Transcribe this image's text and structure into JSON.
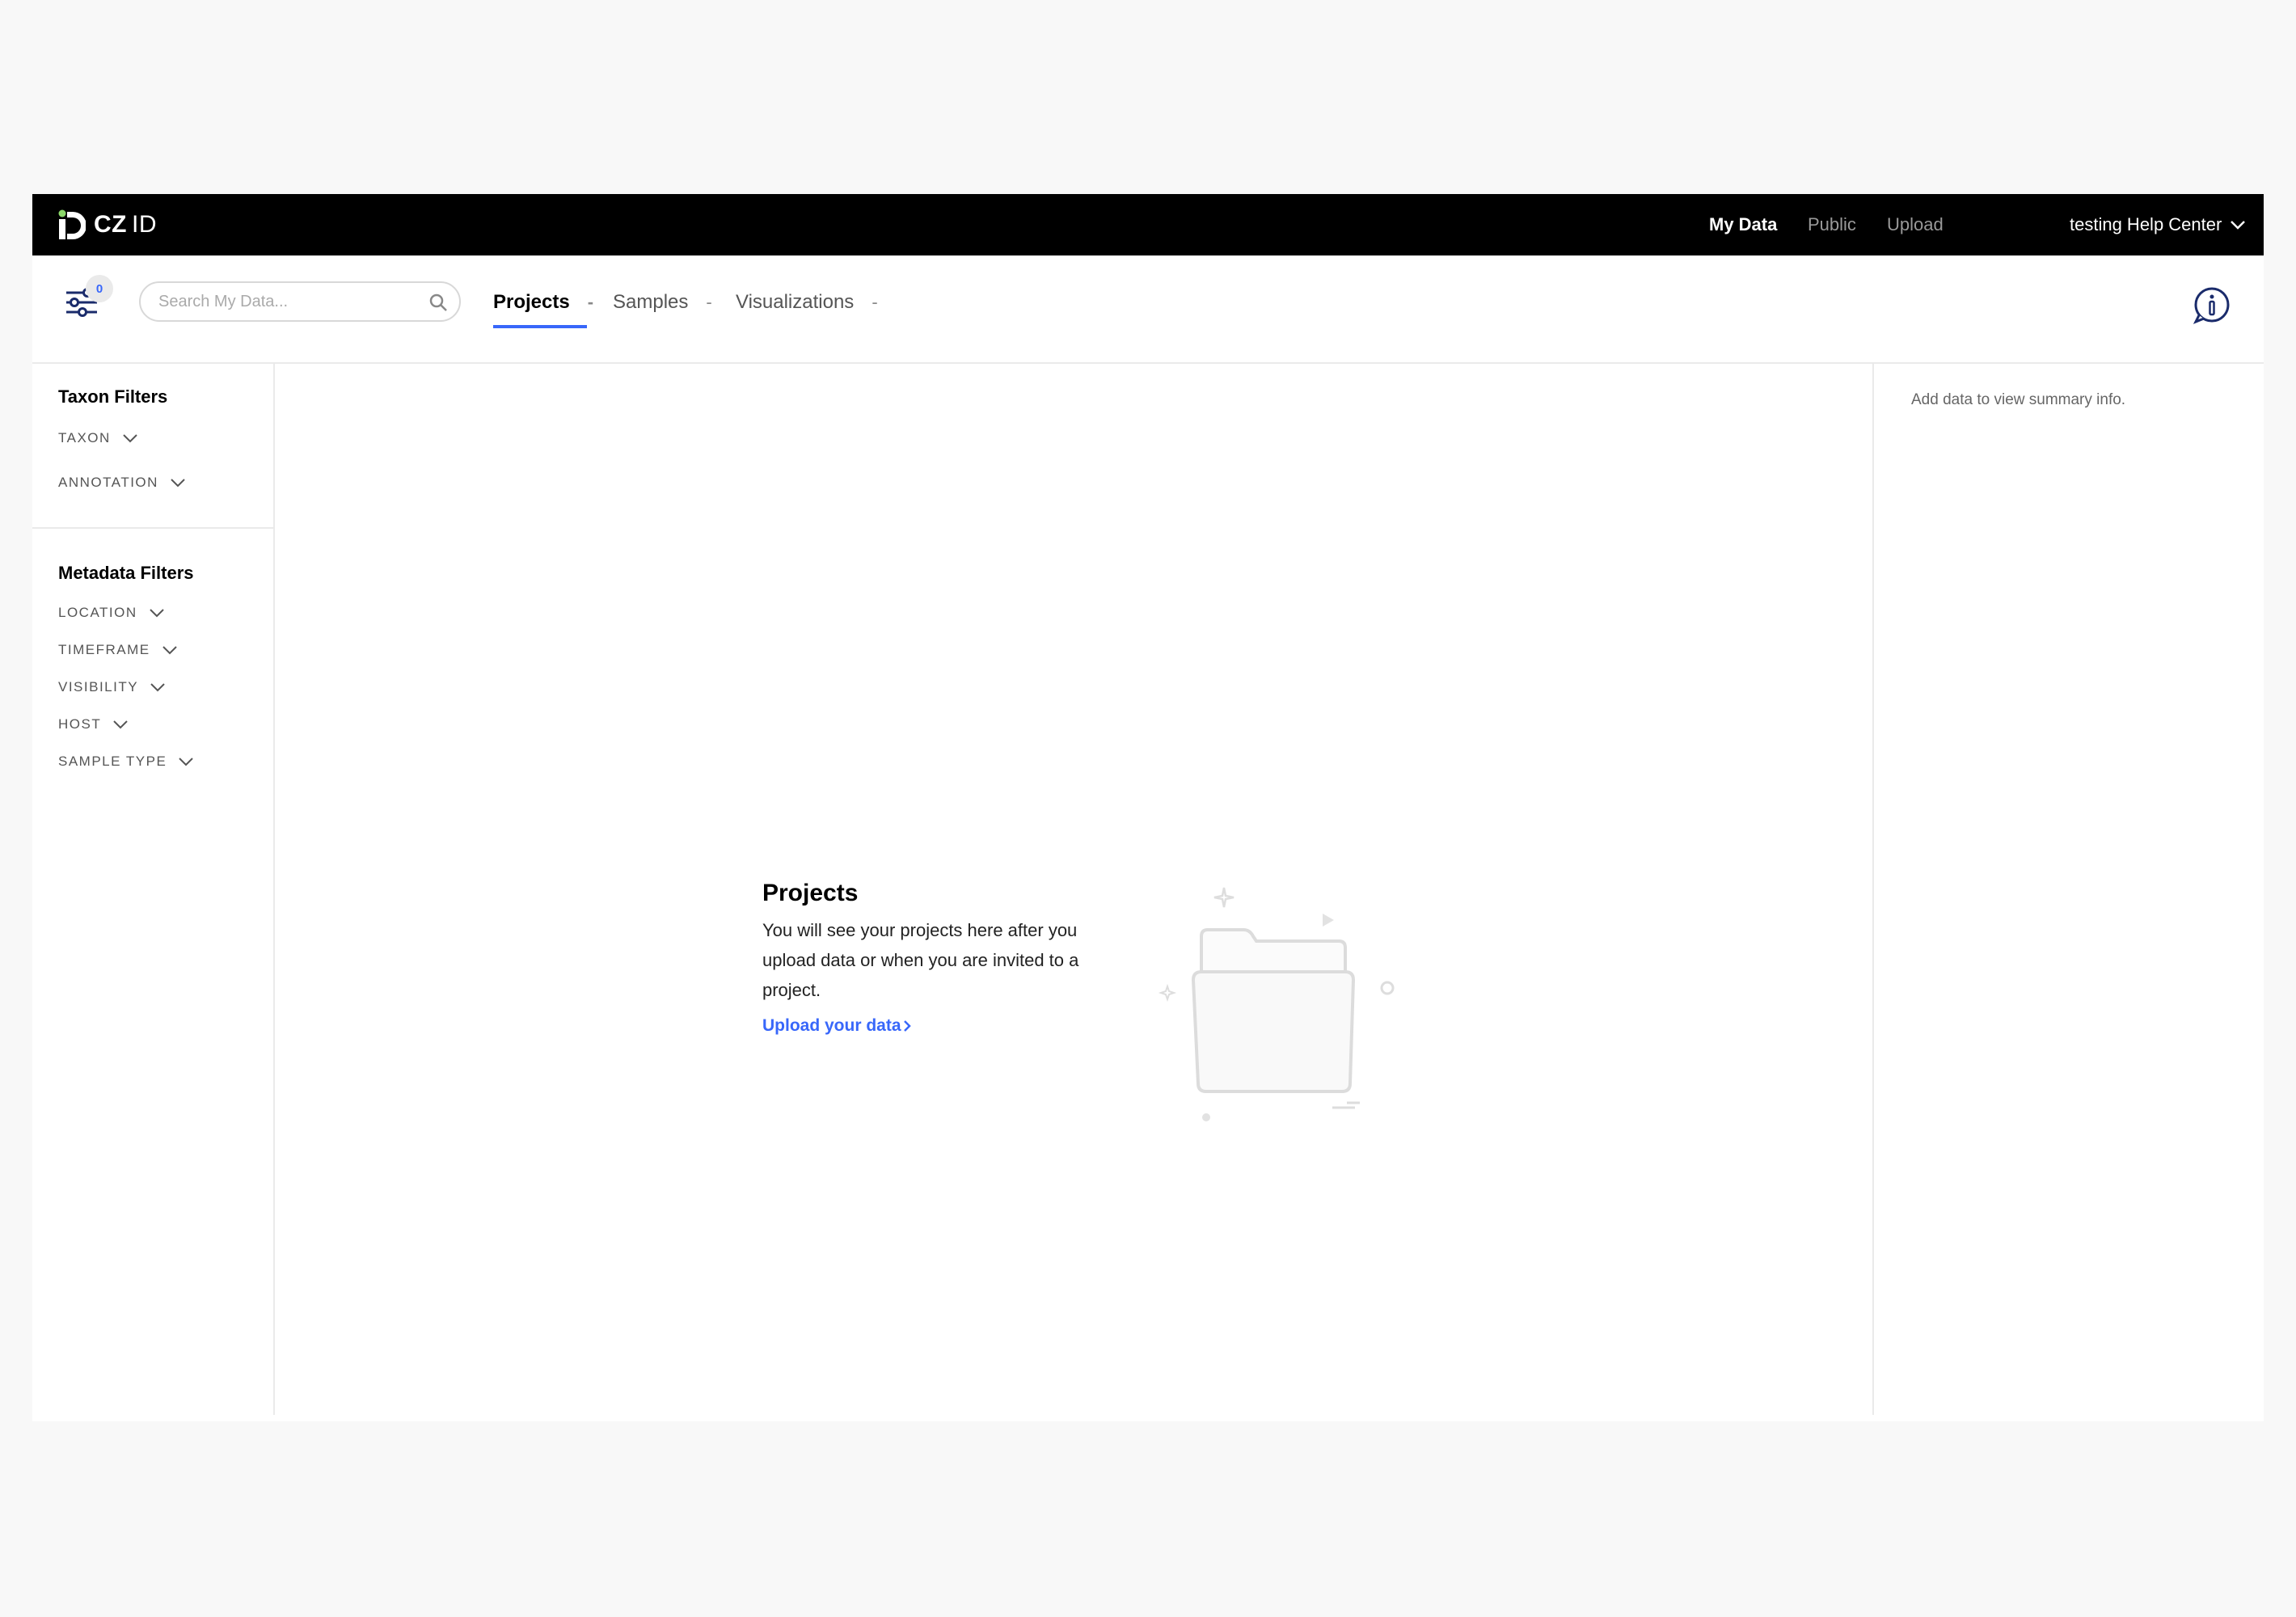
{
  "header": {
    "logo_text": "CZ",
    "logo_text_suffix": "ID",
    "nav": [
      {
        "label": "My Data",
        "active": true
      },
      {
        "label": "Public",
        "active": false
      },
      {
        "label": "Upload",
        "active": false
      }
    ],
    "user_menu_label": "testing Help Center"
  },
  "toolbar": {
    "filter_count": "0",
    "search_placeholder": "Search My Data...",
    "tabs": [
      {
        "label": "Projects",
        "count": "-",
        "active": true
      },
      {
        "label": "Samples",
        "count": "-",
        "active": false
      },
      {
        "label": "Visualizations",
        "count": "-",
        "active": false
      }
    ]
  },
  "sidebar": {
    "taxon_title": "Taxon Filters",
    "taxon_filters": [
      "TAXON",
      "ANNOTATION"
    ],
    "metadata_title": "Metadata Filters",
    "metadata_filters": [
      "LOCATION",
      "TIMEFRAME",
      "VISIBILITY",
      "HOST",
      "SAMPLE TYPE"
    ]
  },
  "main": {
    "empty_title": "Projects",
    "empty_description": "You will see your projects here after you upload data or when you are invited to a project.",
    "upload_link": "Upload your data"
  },
  "summary": {
    "text": "Add data to view summary info."
  },
  "colors": {
    "accent": "#3867fa",
    "header_bg": "#000000",
    "logo_green": "#8cd96a"
  }
}
